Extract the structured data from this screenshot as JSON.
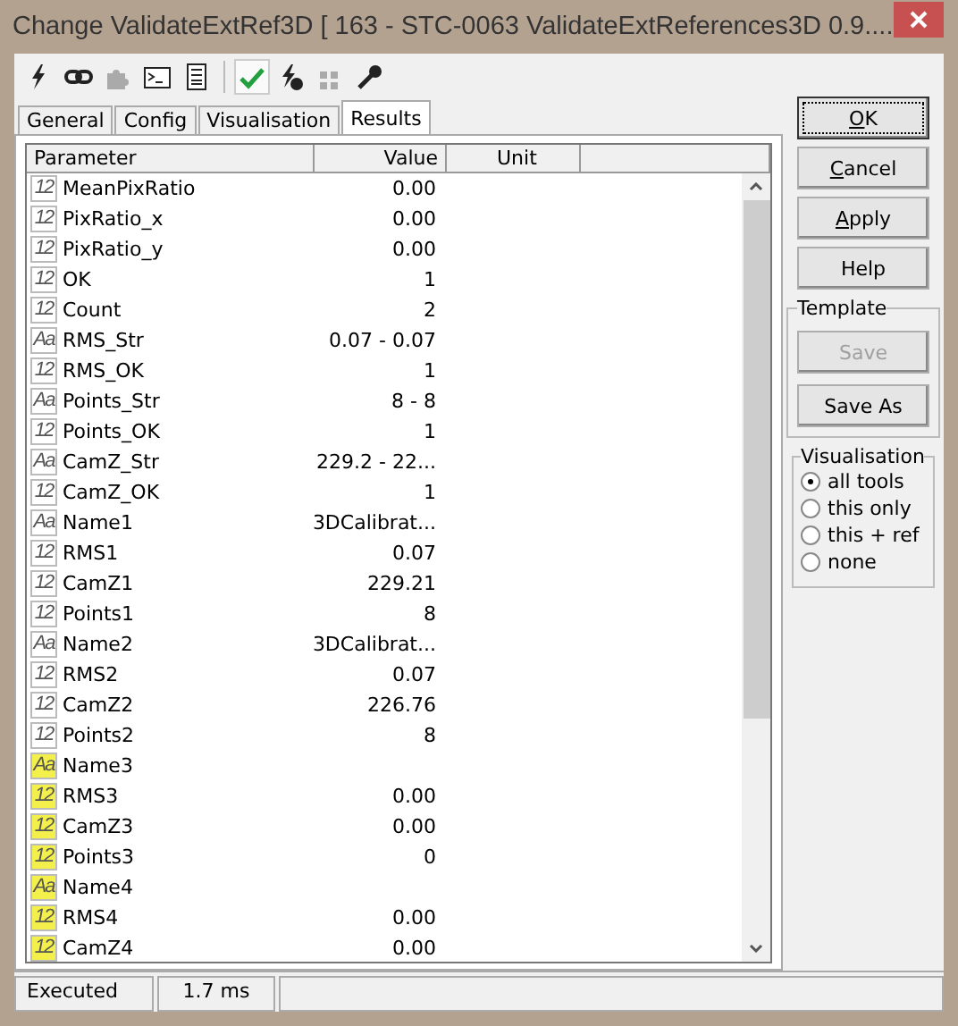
{
  "window": {
    "title": "Change ValidateExtRef3D [ 163 - STC-0063 ValidateExtReferences3D 0.9...."
  },
  "toolbar": [
    {
      "kind": "bolt",
      "pressed": false,
      "disabled": false
    },
    {
      "kind": "link",
      "pressed": false,
      "disabled": false
    },
    {
      "kind": "puzzle",
      "pressed": false,
      "disabled": true
    },
    {
      "kind": "console",
      "pressed": false,
      "disabled": false
    },
    {
      "kind": "document",
      "pressed": false,
      "disabled": false
    },
    {
      "kind": "check",
      "pressed": true,
      "disabled": false
    },
    {
      "kind": "bolt-badge",
      "pressed": false,
      "disabled": false
    },
    {
      "kind": "grid",
      "pressed": false,
      "disabled": true
    },
    {
      "kind": "key",
      "pressed": false,
      "disabled": false
    }
  ],
  "tabs": [
    {
      "label": "General",
      "selected": false
    },
    {
      "label": "Config",
      "selected": false
    },
    {
      "label": "Visualisation",
      "selected": false
    },
    {
      "label": "Results",
      "selected": true
    }
  ],
  "table": {
    "columns": [
      "Parameter",
      "Value",
      "Unit"
    ],
    "rows": [
      {
        "type_label": "12",
        "flagged": false,
        "name": "MeanPixRatio",
        "value": "0.00"
      },
      {
        "type_label": "12",
        "flagged": false,
        "name": "PixRatio_x",
        "value": "0.00"
      },
      {
        "type_label": "12",
        "flagged": false,
        "name": "PixRatio_y",
        "value": "0.00"
      },
      {
        "type_label": "12",
        "flagged": false,
        "name": "OK",
        "value": "1"
      },
      {
        "type_label": "12",
        "flagged": false,
        "name": "Count",
        "value": "2"
      },
      {
        "type_label": "Aa",
        "flagged": false,
        "name": "RMS_Str",
        "value": "0.07 - 0.07"
      },
      {
        "type_label": "12",
        "flagged": false,
        "name": "RMS_OK",
        "value": "1"
      },
      {
        "type_label": "Aa",
        "flagged": false,
        "name": "Points_Str",
        "value": "8 - 8"
      },
      {
        "type_label": "12",
        "flagged": false,
        "name": "Points_OK",
        "value": "1"
      },
      {
        "type_label": "Aa",
        "flagged": false,
        "name": "CamZ_Str",
        "value": "229.2 - 22..."
      },
      {
        "type_label": "12",
        "flagged": false,
        "name": "CamZ_OK",
        "value": "1"
      },
      {
        "type_label": "Aa",
        "flagged": false,
        "name": "Name1",
        "value": "3DCalibrat..."
      },
      {
        "type_label": "12",
        "flagged": false,
        "name": "RMS1",
        "value": "0.07"
      },
      {
        "type_label": "12",
        "flagged": false,
        "name": "CamZ1",
        "value": "229.21"
      },
      {
        "type_label": "12",
        "flagged": false,
        "name": "Points1",
        "value": "8"
      },
      {
        "type_label": "Aa",
        "flagged": false,
        "name": "Name2",
        "value": "3DCalibrat..."
      },
      {
        "type_label": "12",
        "flagged": false,
        "name": "RMS2",
        "value": "0.07"
      },
      {
        "type_label": "12",
        "flagged": false,
        "name": "CamZ2",
        "value": "226.76"
      },
      {
        "type_label": "12",
        "flagged": false,
        "name": "Points2",
        "value": "8"
      },
      {
        "type_label": "Aa",
        "flagged": true,
        "name": "Name3"
      },
      {
        "type_label": "12",
        "flagged": true,
        "name": "RMS3",
        "value": "0.00"
      },
      {
        "type_label": "12",
        "flagged": true,
        "name": "CamZ3",
        "value": "0.00"
      },
      {
        "type_label": "12",
        "flagged": true,
        "name": "Points3",
        "value": "0"
      },
      {
        "type_label": "Aa",
        "flagged": true,
        "name": "Name4"
      },
      {
        "type_label": "12",
        "flagged": true,
        "name": "RMS4",
        "value": "0.00"
      },
      {
        "type_label": "12",
        "flagged": true,
        "name": "CamZ4",
        "value": "0.00"
      }
    ]
  },
  "buttons": [
    {
      "label": "OK",
      "mnemonic_first": true,
      "default": true
    },
    {
      "label": "Cancel",
      "mnemonic_first": true,
      "default": false
    },
    {
      "label": "Apply",
      "mnemonic_first": true,
      "default": false
    },
    {
      "label": "Help",
      "mnemonic_first": false,
      "default": false
    }
  ],
  "template": {
    "title": "Template",
    "buttons": [
      {
        "label": "Save",
        "disabled": true
      },
      {
        "label": "Save As",
        "disabled": false
      }
    ]
  },
  "visualisation": {
    "title": "Visualisation",
    "options": [
      {
        "label": "all tools",
        "selected": true
      },
      {
        "label": "this only",
        "selected": false
      },
      {
        "label": "this + ref",
        "selected": false
      },
      {
        "label": "none",
        "selected": false
      }
    ]
  },
  "status_bar": [
    "Executed",
    "1.7 ms"
  ]
}
